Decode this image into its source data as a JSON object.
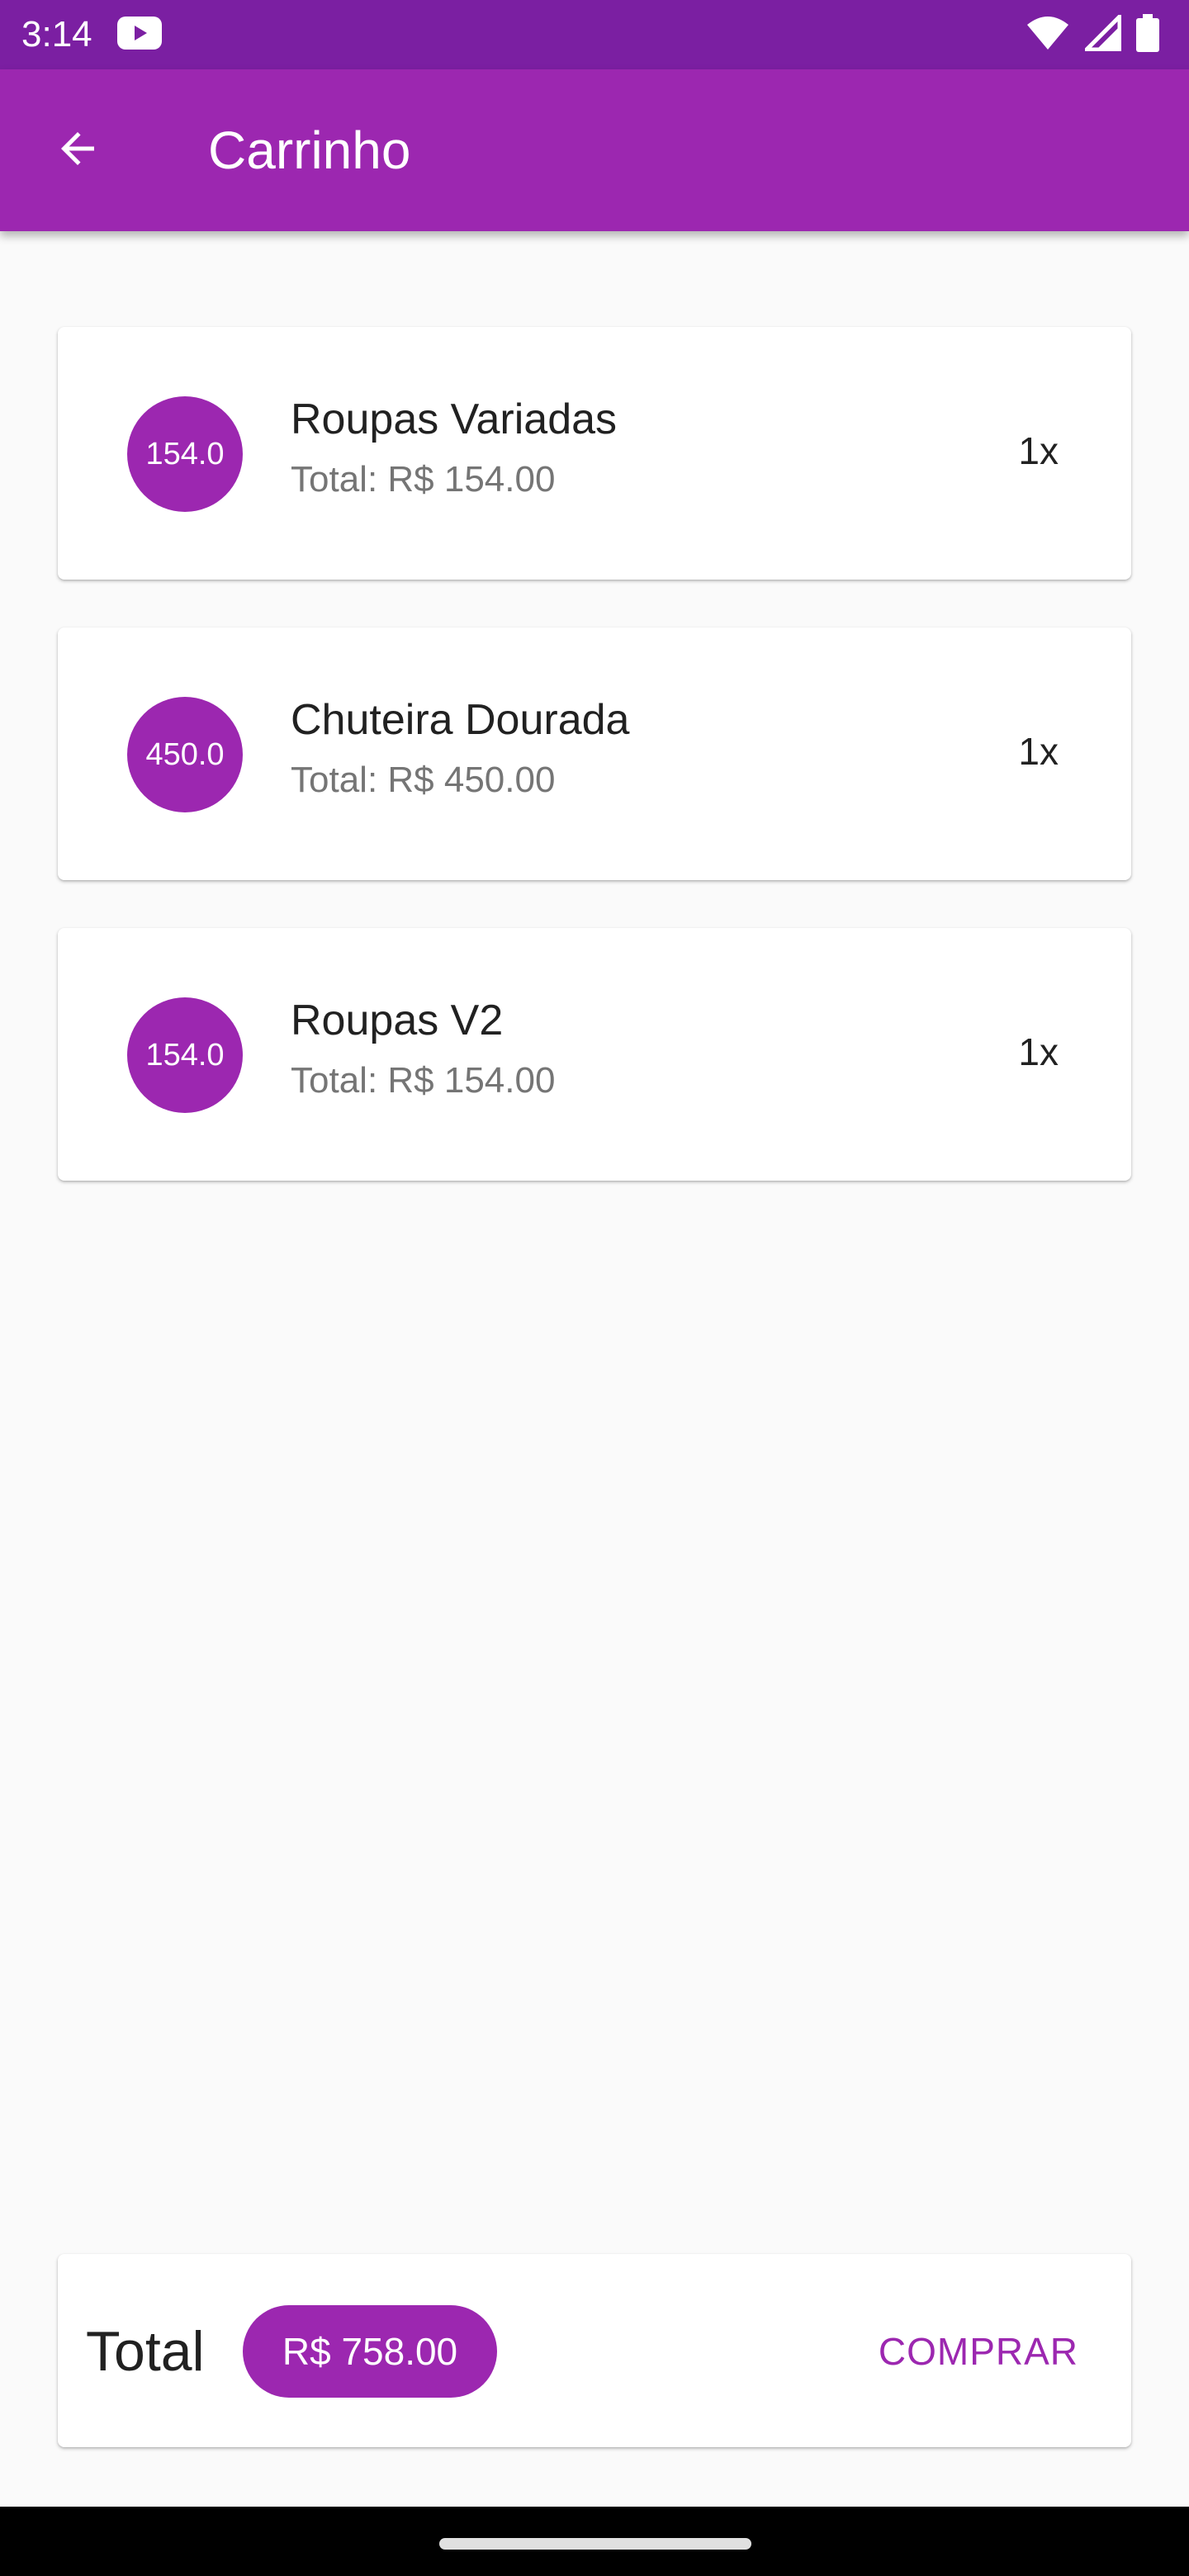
{
  "status_bar": {
    "time": "3:14",
    "icons": [
      "youtube-icon",
      "wifi-icon",
      "signal-icon",
      "battery-icon"
    ]
  },
  "app_bar": {
    "title": "Carrinho",
    "back_icon": "arrow-back-icon"
  },
  "cart": {
    "items": [
      {
        "avatar": "154.0",
        "name": "Roupas Variadas",
        "total": "Total: R$ 154.00",
        "qty": "1x"
      },
      {
        "avatar": "450.0",
        "name": "Chuteira Dourada",
        "total": "Total: R$ 450.00",
        "qty": "1x"
      },
      {
        "avatar": "154.0",
        "name": "Roupas V2",
        "total": "Total: R$ 154.00",
        "qty": "1x"
      }
    ]
  },
  "summary": {
    "label": "Total",
    "amount": "R$ 758.00",
    "buy_label": "COMPRAR"
  },
  "colors": {
    "primary": "#9c27b0",
    "status_bar": "#7b1fa2",
    "background": "#fafafa"
  }
}
